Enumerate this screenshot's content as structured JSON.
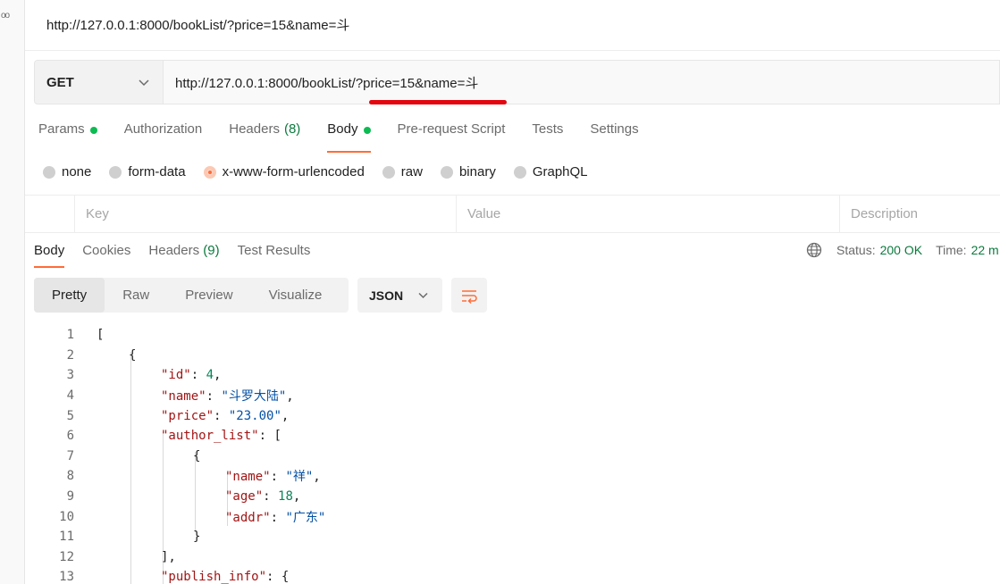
{
  "rail": {
    "dots": "oo"
  },
  "request": {
    "title": "http://127.0.0.1:8000/bookList/?price=15&name=斗",
    "method": "GET",
    "url": "http://127.0.0.1:8000/bookList/?price=15&name=斗"
  },
  "req_tabs": [
    {
      "label": "Params",
      "dot": true
    },
    {
      "label": "Authorization"
    },
    {
      "label": "Headers",
      "count": "(8)"
    },
    {
      "label": "Body",
      "dot": true,
      "active": true
    },
    {
      "label": "Pre-request Script"
    },
    {
      "label": "Tests"
    },
    {
      "label": "Settings"
    }
  ],
  "body_types": [
    {
      "label": "none"
    },
    {
      "label": "form-data"
    },
    {
      "label": "x-www-form-urlencoded",
      "checked": true
    },
    {
      "label": "raw"
    },
    {
      "label": "binary"
    },
    {
      "label": "GraphQL"
    }
  ],
  "kv_headers": {
    "key": "Key",
    "value": "Value",
    "description": "Description"
  },
  "resp_tabs": [
    {
      "label": "Body",
      "active": true
    },
    {
      "label": "Cookies"
    },
    {
      "label": "Headers",
      "count": "(9)"
    },
    {
      "label": "Test Results"
    }
  ],
  "response": {
    "status_label": "Status:",
    "status_value": "200 OK",
    "time_label": "Time:",
    "time_value": "22 m"
  },
  "view_modes": [
    "Pretty",
    "Raw",
    "Preview",
    "Visualize"
  ],
  "format": "JSON",
  "colors": {
    "accent": "#ff6c37",
    "success": "#0cbb52",
    "underline": "#e3060f"
  },
  "code_lines": [
    {
      "n": "1",
      "text": "["
    },
    {
      "n": "2",
      "text": "{"
    },
    {
      "n": "3",
      "key": "\"id\"",
      "sep": ": ",
      "num": "4",
      "tail": ","
    },
    {
      "n": "4",
      "key": "\"name\"",
      "sep": ": ",
      "str": "\"斗罗大陆\"",
      "tail": ","
    },
    {
      "n": "5",
      "key": "\"price\"",
      "sep": ": ",
      "str": "\"23.00\"",
      "tail": ","
    },
    {
      "n": "6",
      "key": "\"author_list\"",
      "sep": ": ",
      "tail": "["
    },
    {
      "n": "7",
      "text": "{"
    },
    {
      "n": "8",
      "key": "\"name\"",
      "sep": ": ",
      "str": "\"祥\"",
      "tail": ","
    },
    {
      "n": "9",
      "key": "\"age\"",
      "sep": ": ",
      "num": "18",
      "tail": ","
    },
    {
      "n": "10",
      "key": "\"addr\"",
      "sep": ": ",
      "str": "\"广东\""
    },
    {
      "n": "11",
      "text": "}"
    },
    {
      "n": "12",
      "text": "],"
    },
    {
      "n": "13",
      "key": "\"publish_info\"",
      "sep": ": ",
      "tail": "{"
    }
  ]
}
